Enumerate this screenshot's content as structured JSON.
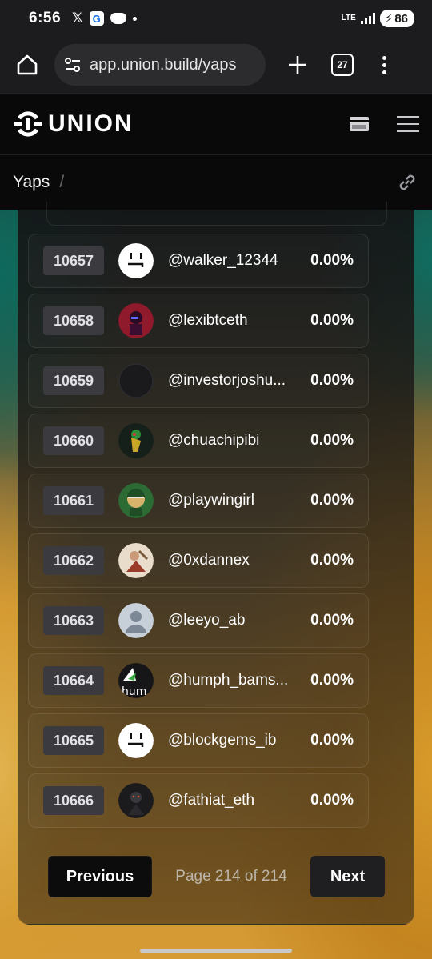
{
  "status_bar": {
    "time": "6:56",
    "network": "LTE",
    "battery": "86"
  },
  "browser": {
    "url": "app.union.build/yaps",
    "tab_count": "27"
  },
  "site": {
    "logo_text": "UNION"
  },
  "breadcrumb": {
    "current": "Yaps",
    "separator": "/"
  },
  "leaderboard": {
    "rows": [
      {
        "rank": "10657",
        "handle": "@walker_12344",
        "percent": "0.00%",
        "avatar": "default-face"
      },
      {
        "rank": "10658",
        "handle": "@lexibtceth",
        "percent": "0.00%",
        "avatar": "red-figure"
      },
      {
        "rank": "10659",
        "handle": "@investorjoshu...",
        "percent": "0.00%",
        "avatar": "empty"
      },
      {
        "rank": "10660",
        "handle": "@chuachipibi",
        "percent": "0.00%",
        "avatar": "bird"
      },
      {
        "rank": "10661",
        "handle": "@playwingirl",
        "percent": "0.00%",
        "avatar": "green-helmet"
      },
      {
        "rank": "10662",
        "handle": "@0xdannex",
        "percent": "0.00%",
        "avatar": "painting"
      },
      {
        "rank": "10663",
        "handle": "@leeyo_ab",
        "percent": "0.00%",
        "avatar": "default-user"
      },
      {
        "rank": "10664",
        "handle": "@humph_bams...",
        "percent": "0.00%",
        "avatar": "hum-text"
      },
      {
        "rank": "10665",
        "handle": "@blockgems_ib",
        "percent": "0.00%",
        "avatar": "default-face"
      },
      {
        "rank": "10666",
        "handle": "@fathiat_eth",
        "percent": "0.00%",
        "avatar": "dark-figure"
      }
    ]
  },
  "pagination": {
    "previous_label": "Previous",
    "page_label": "Page 214 of 214",
    "next_label": "Next"
  },
  "colors": {
    "accent_gold": "#d69b34",
    "accent_teal": "#0e6a5e",
    "rank_badge": "#3a3a3f"
  }
}
